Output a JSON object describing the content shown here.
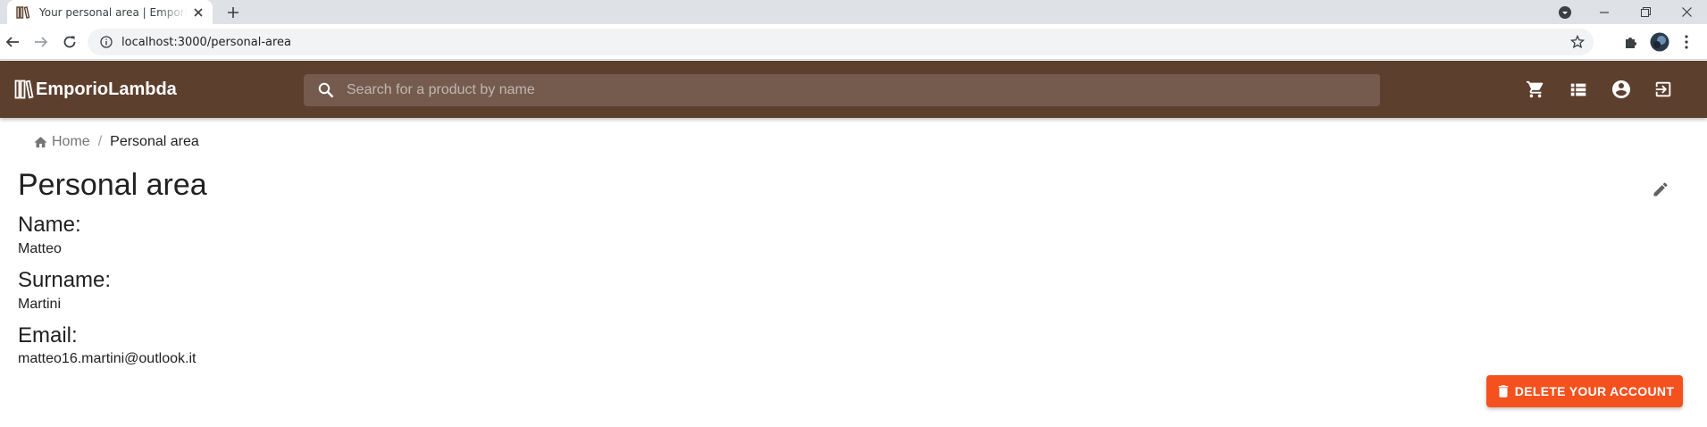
{
  "browser": {
    "tab_title": "Your personal area | EmporioLambda",
    "url": "localhost:3000/personal-area"
  },
  "appbar": {
    "brand": "EmporioLambda",
    "search_placeholder": "Search for a product by name",
    "icons": [
      "cart-icon",
      "list-icon",
      "account-circle-icon",
      "logout-icon"
    ],
    "color": "#5d3f2e"
  },
  "breadcrumb": {
    "home": "Home",
    "separator": "/",
    "current": "Personal area"
  },
  "page": {
    "title": "Personal area",
    "fields": {
      "name_label": "Name:",
      "name_value": "Matteo",
      "surname_label": "Surname:",
      "surname_value": "Martini",
      "email_label": "Email:",
      "email_value": "matteo16.martini@outlook.it"
    },
    "delete_button": "DELETE YOUR ACCOUNT",
    "delete_color": "#f4511e"
  }
}
